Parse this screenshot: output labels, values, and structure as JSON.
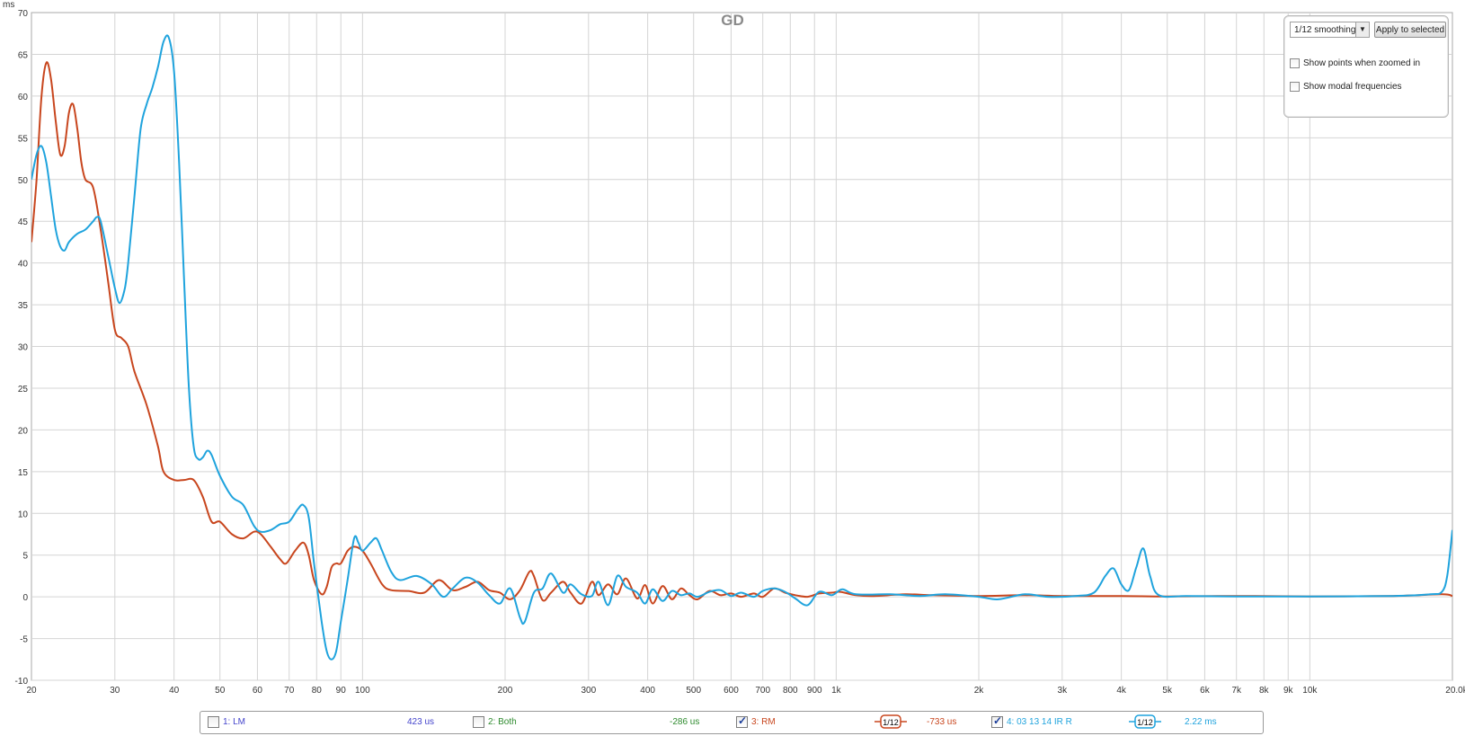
{
  "chart_data": {
    "type": "line",
    "title": "GD",
    "ylabel": "ms",
    "xunit": "Hz",
    "xscale": "log",
    "xlim": [
      20,
      20000
    ],
    "ylim": [
      -10,
      70
    ],
    "yticks": [
      -10,
      -5,
      0,
      5,
      10,
      15,
      20,
      25,
      30,
      35,
      40,
      45,
      50,
      55,
      60,
      65,
      70
    ],
    "xticks": [
      {
        "v": 20,
        "l": "20"
      },
      {
        "v": 30,
        "l": "30"
      },
      {
        "v": 40,
        "l": "40"
      },
      {
        "v": 50,
        "l": "50"
      },
      {
        "v": 60,
        "l": "60"
      },
      {
        "v": 70,
        "l": "70"
      },
      {
        "v": 80,
        "l": "80"
      },
      {
        "v": 90,
        "l": "90"
      },
      {
        "v": 100,
        "l": "100"
      },
      {
        "v": 200,
        "l": "200"
      },
      {
        "v": 300,
        "l": "300"
      },
      {
        "v": 400,
        "l": "400"
      },
      {
        "v": 500,
        "l": "500"
      },
      {
        "v": 600,
        "l": "600"
      },
      {
        "v": 700,
        "l": "700"
      },
      {
        "v": 800,
        "l": "800"
      },
      {
        "v": 900,
        "l": "900"
      },
      {
        "v": 1000,
        "l": "1k"
      },
      {
        "v": 2000,
        "l": "2k"
      },
      {
        "v": 3000,
        "l": "3k"
      },
      {
        "v": 4000,
        "l": "4k"
      },
      {
        "v": 5000,
        "l": "5k"
      },
      {
        "v": 6000,
        "l": "6k"
      },
      {
        "v": 7000,
        "l": "7k"
      },
      {
        "v": 8000,
        "l": "8k"
      },
      {
        "v": 9000,
        "l": "9k"
      },
      {
        "v": 10000,
        "l": "10k"
      },
      {
        "v": 20000,
        "l": "20.0k Hz"
      }
    ],
    "grid": true,
    "series": [
      {
        "name": "3: RM",
        "color": "#c8461e",
        "points": [
          [
            20,
            42.5
          ],
          [
            20.5,
            50
          ],
          [
            21,
            60
          ],
          [
            21.5,
            64
          ],
          [
            22,
            62
          ],
          [
            22.5,
            57
          ],
          [
            23,
            53
          ],
          [
            23.5,
            54
          ],
          [
            24,
            58
          ],
          [
            24.5,
            59
          ],
          [
            25,
            56
          ],
          [
            25.5,
            52
          ],
          [
            26,
            50
          ],
          [
            27,
            49
          ],
          [
            28,
            44
          ],
          [
            29,
            38
          ],
          [
            30,
            32
          ],
          [
            31,
            31
          ],
          [
            32,
            30
          ],
          [
            33,
            27
          ],
          [
            35,
            23
          ],
          [
            37,
            18
          ],
          [
            38,
            15
          ],
          [
            40,
            14
          ],
          [
            42,
            14
          ],
          [
            44,
            14
          ],
          [
            46,
            12
          ],
          [
            48,
            9
          ],
          [
            50,
            9
          ],
          [
            53,
            7.5
          ],
          [
            56,
            7
          ],
          [
            59,
            7.8
          ],
          [
            61,
            7.5
          ],
          [
            64,
            6
          ],
          [
            67,
            4.5
          ],
          [
            69,
            4
          ],
          [
            72,
            5.5
          ],
          [
            75,
            6.5
          ],
          [
            77,
            5
          ],
          [
            79,
            2
          ],
          [
            82,
            0.3
          ],
          [
            84,
            1.2
          ],
          [
            86,
            3.5
          ],
          [
            88,
            4
          ],
          [
            90,
            4
          ],
          [
            93,
            5.5
          ],
          [
            96,
            6
          ],
          [
            100,
            5.5
          ],
          [
            104,
            4
          ],
          [
            110,
            1.5
          ],
          [
            115,
            0.8
          ],
          [
            125,
            0.7
          ],
          [
            135,
            0.5
          ],
          [
            145,
            2
          ],
          [
            155,
            0.8
          ],
          [
            165,
            1.2
          ],
          [
            175,
            1.8
          ],
          [
            185,
            0.8
          ],
          [
            195,
            0.5
          ],
          [
            205,
            -0.3
          ],
          [
            215,
            0.8
          ],
          [
            225,
            3
          ],
          [
            230,
            2.5
          ],
          [
            240,
            -0.4
          ],
          [
            250,
            0.5
          ],
          [
            265,
            1.8
          ],
          [
            275,
            0.5
          ],
          [
            290,
            -0.8
          ],
          [
            305,
            1.8
          ],
          [
            315,
            0.2
          ],
          [
            330,
            1.5
          ],
          [
            345,
            0.3
          ],
          [
            360,
            2.2
          ],
          [
            380,
            -0.2
          ],
          [
            395,
            1.4
          ],
          [
            410,
            -0.8
          ],
          [
            430,
            1.3
          ],
          [
            450,
            -0.3
          ],
          [
            470,
            1
          ],
          [
            490,
            0.2
          ],
          [
            510,
            -0.3
          ],
          [
            540,
            0.7
          ],
          [
            570,
            0.2
          ],
          [
            600,
            0.4
          ],
          [
            630,
            0
          ],
          [
            670,
            0.4
          ],
          [
            700,
            0
          ],
          [
            740,
            1
          ],
          [
            780,
            0.5
          ],
          [
            820,
            0.2
          ],
          [
            870,
            0
          ],
          [
            920,
            0.4
          ],
          [
            980,
            0.5
          ],
          [
            1020,
            0.6
          ],
          [
            1100,
            0.2
          ],
          [
            1200,
            0.1
          ],
          [
            1400,
            0.3
          ],
          [
            1600,
            0.2
          ],
          [
            2000,
            0.1
          ],
          [
            2500,
            0.2
          ],
          [
            3000,
            0.1
          ],
          [
            4000,
            0.1
          ],
          [
            5000,
            0.05
          ],
          [
            7000,
            0.1
          ],
          [
            10000,
            0.05
          ],
          [
            15000,
            0.1
          ],
          [
            19000,
            0.3
          ],
          [
            20000,
            0.1
          ]
        ]
      },
      {
        "name": "4: 03 13 14 IR R",
        "color": "#1fa3dd",
        "points": [
          [
            20,
            50
          ],
          [
            20.5,
            53
          ],
          [
            21,
            54
          ],
          [
            21.5,
            52
          ],
          [
            22,
            48
          ],
          [
            22.5,
            44
          ],
          [
            23,
            42
          ],
          [
            23.5,
            41.5
          ],
          [
            24,
            42.5
          ],
          [
            25,
            43.5
          ],
          [
            26,
            44
          ],
          [
            27,
            45
          ],
          [
            27.5,
            45.5
          ],
          [
            28,
            45
          ],
          [
            29,
            41
          ],
          [
            30,
            37
          ],
          [
            30.7,
            35.2
          ],
          [
            31.5,
            37
          ],
          [
            32,
            40
          ],
          [
            33,
            48
          ],
          [
            34,
            56
          ],
          [
            35,
            59
          ],
          [
            36,
            61
          ],
          [
            37,
            63.5
          ],
          [
            38,
            66.5
          ],
          [
            39,
            67
          ],
          [
            40,
            63
          ],
          [
            41,
            52
          ],
          [
            42,
            38
          ],
          [
            43,
            25
          ],
          [
            44,
            18
          ],
          [
            45,
            16.5
          ],
          [
            46,
            16.7
          ],
          [
            47,
            17.5
          ],
          [
            48,
            17
          ],
          [
            50,
            14.5
          ],
          [
            53,
            12
          ],
          [
            56,
            11
          ],
          [
            59,
            8.5
          ],
          [
            61,
            7.8
          ],
          [
            64,
            8
          ],
          [
            67,
            8.7
          ],
          [
            70,
            9
          ],
          [
            73,
            10.5
          ],
          [
            75,
            11
          ],
          [
            77,
            9.5
          ],
          [
            79,
            4
          ],
          [
            82,
            -3
          ],
          [
            84,
            -6.5
          ],
          [
            86,
            -7.5
          ],
          [
            88,
            -6.5
          ],
          [
            90,
            -3
          ],
          [
            93,
            2
          ],
          [
            96,
            7
          ],
          [
            98,
            6.5
          ],
          [
            100,
            5.5
          ],
          [
            104,
            6.5
          ],
          [
            107,
            7
          ],
          [
            110,
            5.5
          ],
          [
            115,
            3
          ],
          [
            120,
            2
          ],
          [
            130,
            2.5
          ],
          [
            140,
            1.5
          ],
          [
            148,
            0
          ],
          [
            155,
            1
          ],
          [
            165,
            2.3
          ],
          [
            175,
            1.7
          ],
          [
            185,
            0.2
          ],
          [
            195,
            -0.8
          ],
          [
            205,
            1
          ],
          [
            215,
            -2.5
          ],
          [
            220,
            -3
          ],
          [
            230,
            0.5
          ],
          [
            240,
            1
          ],
          [
            250,
            2.8
          ],
          [
            265,
            0.5
          ],
          [
            275,
            1.5
          ],
          [
            290,
            0.3
          ],
          [
            305,
            0.1
          ],
          [
            315,
            1.8
          ],
          [
            330,
            -1
          ],
          [
            345,
            2.5
          ],
          [
            360,
            1.2
          ],
          [
            380,
            0.5
          ],
          [
            395,
            -0.8
          ],
          [
            410,
            0.9
          ],
          [
            430,
            -0.5
          ],
          [
            450,
            0.7
          ],
          [
            470,
            0.2
          ],
          [
            490,
            0.4
          ],
          [
            510,
            0
          ],
          [
            540,
            0.6
          ],
          [
            570,
            0.8
          ],
          [
            600,
            0.1
          ],
          [
            630,
            0.5
          ],
          [
            670,
            0
          ],
          [
            700,
            0.7
          ],
          [
            740,
            1
          ],
          [
            780,
            0.6
          ],
          [
            820,
            -0.2
          ],
          [
            870,
            -1
          ],
          [
            920,
            0.6
          ],
          [
            980,
            0.2
          ],
          [
            1030,
            0.9
          ],
          [
            1100,
            0.3
          ],
          [
            1300,
            0.3
          ],
          [
            1500,
            0.1
          ],
          [
            1700,
            0.3
          ],
          [
            2000,
            0
          ],
          [
            2200,
            -0.3
          ],
          [
            2500,
            0.3
          ],
          [
            2800,
            0
          ],
          [
            3200,
            0.1
          ],
          [
            3500,
            0.5
          ],
          [
            3700,
            2.5
          ],
          [
            3850,
            3.4
          ],
          [
            4000,
            1.5
          ],
          [
            4150,
            0.8
          ],
          [
            4300,
            3.5
          ],
          [
            4450,
            5.8
          ],
          [
            4600,
            2.5
          ],
          [
            4800,
            0.2
          ],
          [
            5500,
            0.1
          ],
          [
            7000,
            0.05
          ],
          [
            10000,
            0.05
          ],
          [
            15000,
            0.1
          ],
          [
            18000,
            0.3
          ],
          [
            19000,
            0.6
          ],
          [
            19500,
            2.5
          ],
          [
            20000,
            8
          ]
        ]
      }
    ]
  },
  "controls": {
    "smoothing_value": "1/12 smoothing",
    "apply_label": "Apply to selected",
    "show_points_label": "Show points when zoomed in",
    "show_modal_label": "Show modal frequencies"
  },
  "legend": {
    "items": [
      {
        "label": "1: LM",
        "value": "423 us",
        "checked": false,
        "color": "#4444cc"
      },
      {
        "label": "2: Both",
        "value": "-286 us",
        "checked": false,
        "color": "#2e8b2e"
      },
      {
        "label": "3: RM",
        "value": "-733 us",
        "checked": true,
        "color": "#c8461e",
        "smoothing": "1/12"
      },
      {
        "label": "4: 03 13 14 IR R",
        "value": "2.22 ms",
        "checked": true,
        "color": "#1fa3dd",
        "smoothing": "1/12"
      }
    ]
  }
}
